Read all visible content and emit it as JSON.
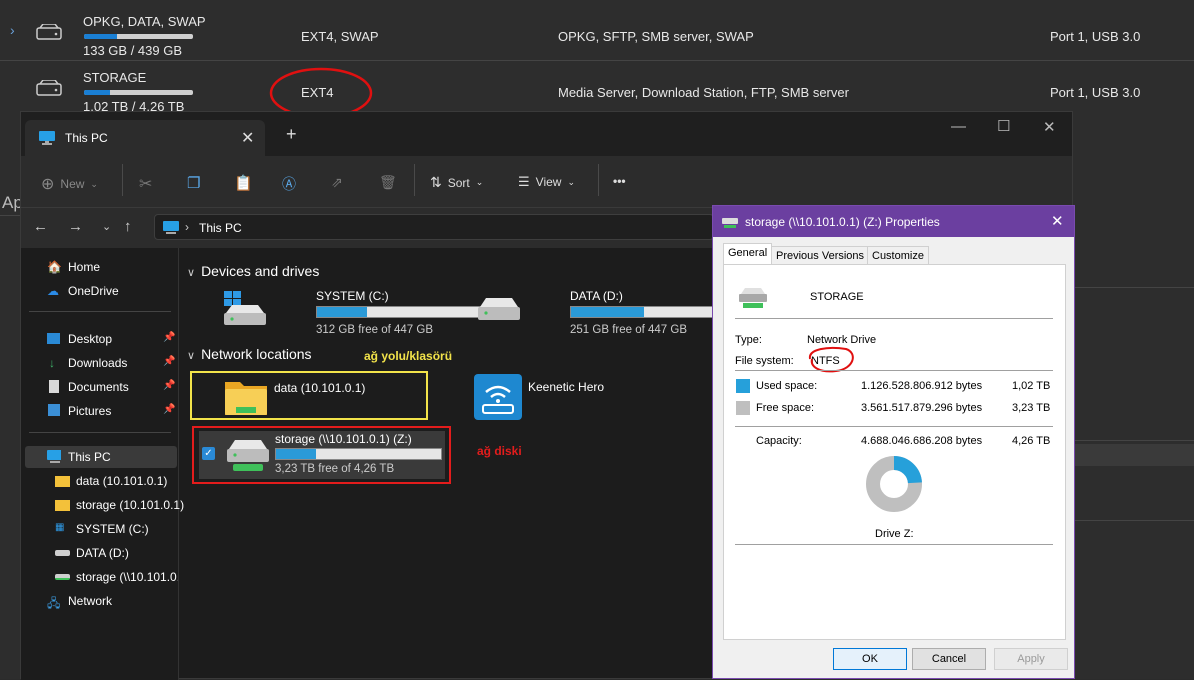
{
  "nas": {
    "rows": [
      {
        "name": "OPKG, DATA, SWAP",
        "size": "133 GB / 439 GB",
        "usage": 0.3,
        "fs": "EXT4, SWAP",
        "services": "OPKG, SFTP, SMB server, SWAP",
        "port": "Port 1, USB 3.0"
      },
      {
        "name": "STORAGE",
        "size": "1.02 TB / 4.26 TB",
        "usage": 0.24,
        "fs": "EXT4",
        "services": "Media Server, Download Station, FTP, SMB server",
        "port": "Port 1, USB 3.0"
      }
    ],
    "partial_heading": "Ap"
  },
  "explorer": {
    "tab_title": "This PC",
    "toolbar": {
      "new": "New",
      "sort": "Sort",
      "view": "View",
      "more": "•••"
    },
    "address": "This PC",
    "sidebar": [
      {
        "label": "Home",
        "icon": "home-icon"
      },
      {
        "label": "OneDrive",
        "icon": "cloud-icon"
      },
      {
        "label": "Desktop",
        "icon": "desktop-icon",
        "pinned": true
      },
      {
        "label": "Downloads",
        "icon": "download-icon",
        "pinned": true
      },
      {
        "label": "Documents",
        "icon": "document-icon",
        "pinned": true
      },
      {
        "label": "Pictures",
        "icon": "picture-icon",
        "pinned": true
      },
      {
        "label": "This PC",
        "icon": "monitor-icon"
      },
      {
        "label": "data (10.101.0.1)",
        "icon": "folder-icon"
      },
      {
        "label": "storage (10.101.0.1)",
        "icon": "folder-icon"
      },
      {
        "label": "SYSTEM (C:)",
        "icon": "windows-drive-icon"
      },
      {
        "label": "DATA (D:)",
        "icon": "drive-icon"
      },
      {
        "label": "storage (\\\\10.101.0.",
        "icon": "network-drive-icon"
      },
      {
        "label": "Network",
        "icon": "network-icon"
      }
    ],
    "sections": {
      "devices": "Devices and drives",
      "network": "Network locations"
    },
    "drives": [
      {
        "name": "SYSTEM (C:)",
        "free": "312 GB free of 447 GB",
        "usage": 0.3
      },
      {
        "name": "DATA (D:)",
        "free": "251 GB free of 447 GB",
        "usage": 0.44
      }
    ],
    "network_items": [
      {
        "name": "data (10.101.0.1)"
      },
      {
        "name": "Keenetic Hero"
      },
      {
        "name": "storage (\\\\10.101.0.1) (Z:)",
        "free": "3,23 TB free of 4,26 TB",
        "usage": 0.24
      }
    ],
    "annotations": {
      "folder": "ağ yolu/klasörü",
      "disk": "ağ diski"
    }
  },
  "dialog": {
    "title": "storage (\\\\10.101.0.1) (Z:) Properties",
    "tabs": [
      "General",
      "Previous Versions",
      "Customize"
    ],
    "label": "STORAGE",
    "type_label": "Type:",
    "type_value": "Network Drive",
    "fs_label": "File system:",
    "fs_value": "NTFS",
    "used_label": "Used space:",
    "used_bytes": "1.126.528.806.912 bytes",
    "used_h": "1,02 TB",
    "free_label": "Free space:",
    "free_bytes": "3.561.517.879.296 bytes",
    "free_h": "3,23 TB",
    "cap_label": "Capacity:",
    "cap_bytes": "4.688.046.686.208 bytes",
    "cap_h": "4,26 TB",
    "used_fraction": 0.24,
    "drive_label": "Drive Z:",
    "buttons": {
      "ok": "OK",
      "cancel": "Cancel",
      "apply": "Apply"
    },
    "colors": {
      "used": "#26a0da",
      "free": "#bfbfbf"
    }
  }
}
